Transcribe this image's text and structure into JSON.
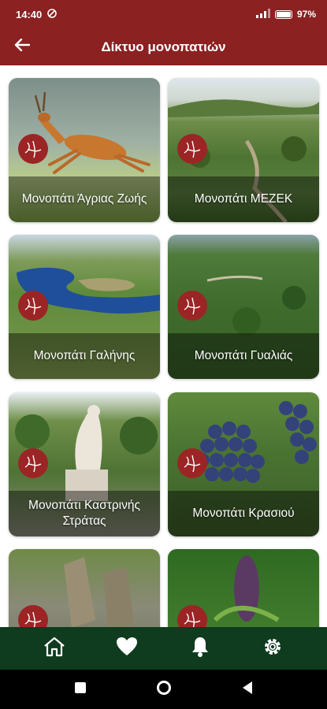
{
  "status_bar": {
    "time": "14:40",
    "battery": "97"
  },
  "app_bar": {
    "title": "Δίκτυο μονοπατιών",
    "back_icon": "arrow-left-icon"
  },
  "trails": [
    {
      "label": "Μονοπάτι Άγριας Ζωής"
    },
    {
      "label": "Μονοπάτι ΜΕΖΕΚ"
    },
    {
      "label": "Μονοπάτι Γαλήνης"
    },
    {
      "label": "Μονοπάτι Γυαλιάς"
    },
    {
      "label": "Μονοπάτι Καστρινής Στράτας"
    },
    {
      "label": "Μονοπάτι Κρασιού"
    },
    {
      "label": ""
    },
    {
      "label": ""
    }
  ],
  "bottom_nav": [
    "home-icon",
    "heart-icon",
    "bell-icon",
    "gear-icon"
  ],
  "colors": {
    "primary": "#8b2121",
    "nav_bg": "#0f3b1e",
    "badge": "#9b2525"
  }
}
